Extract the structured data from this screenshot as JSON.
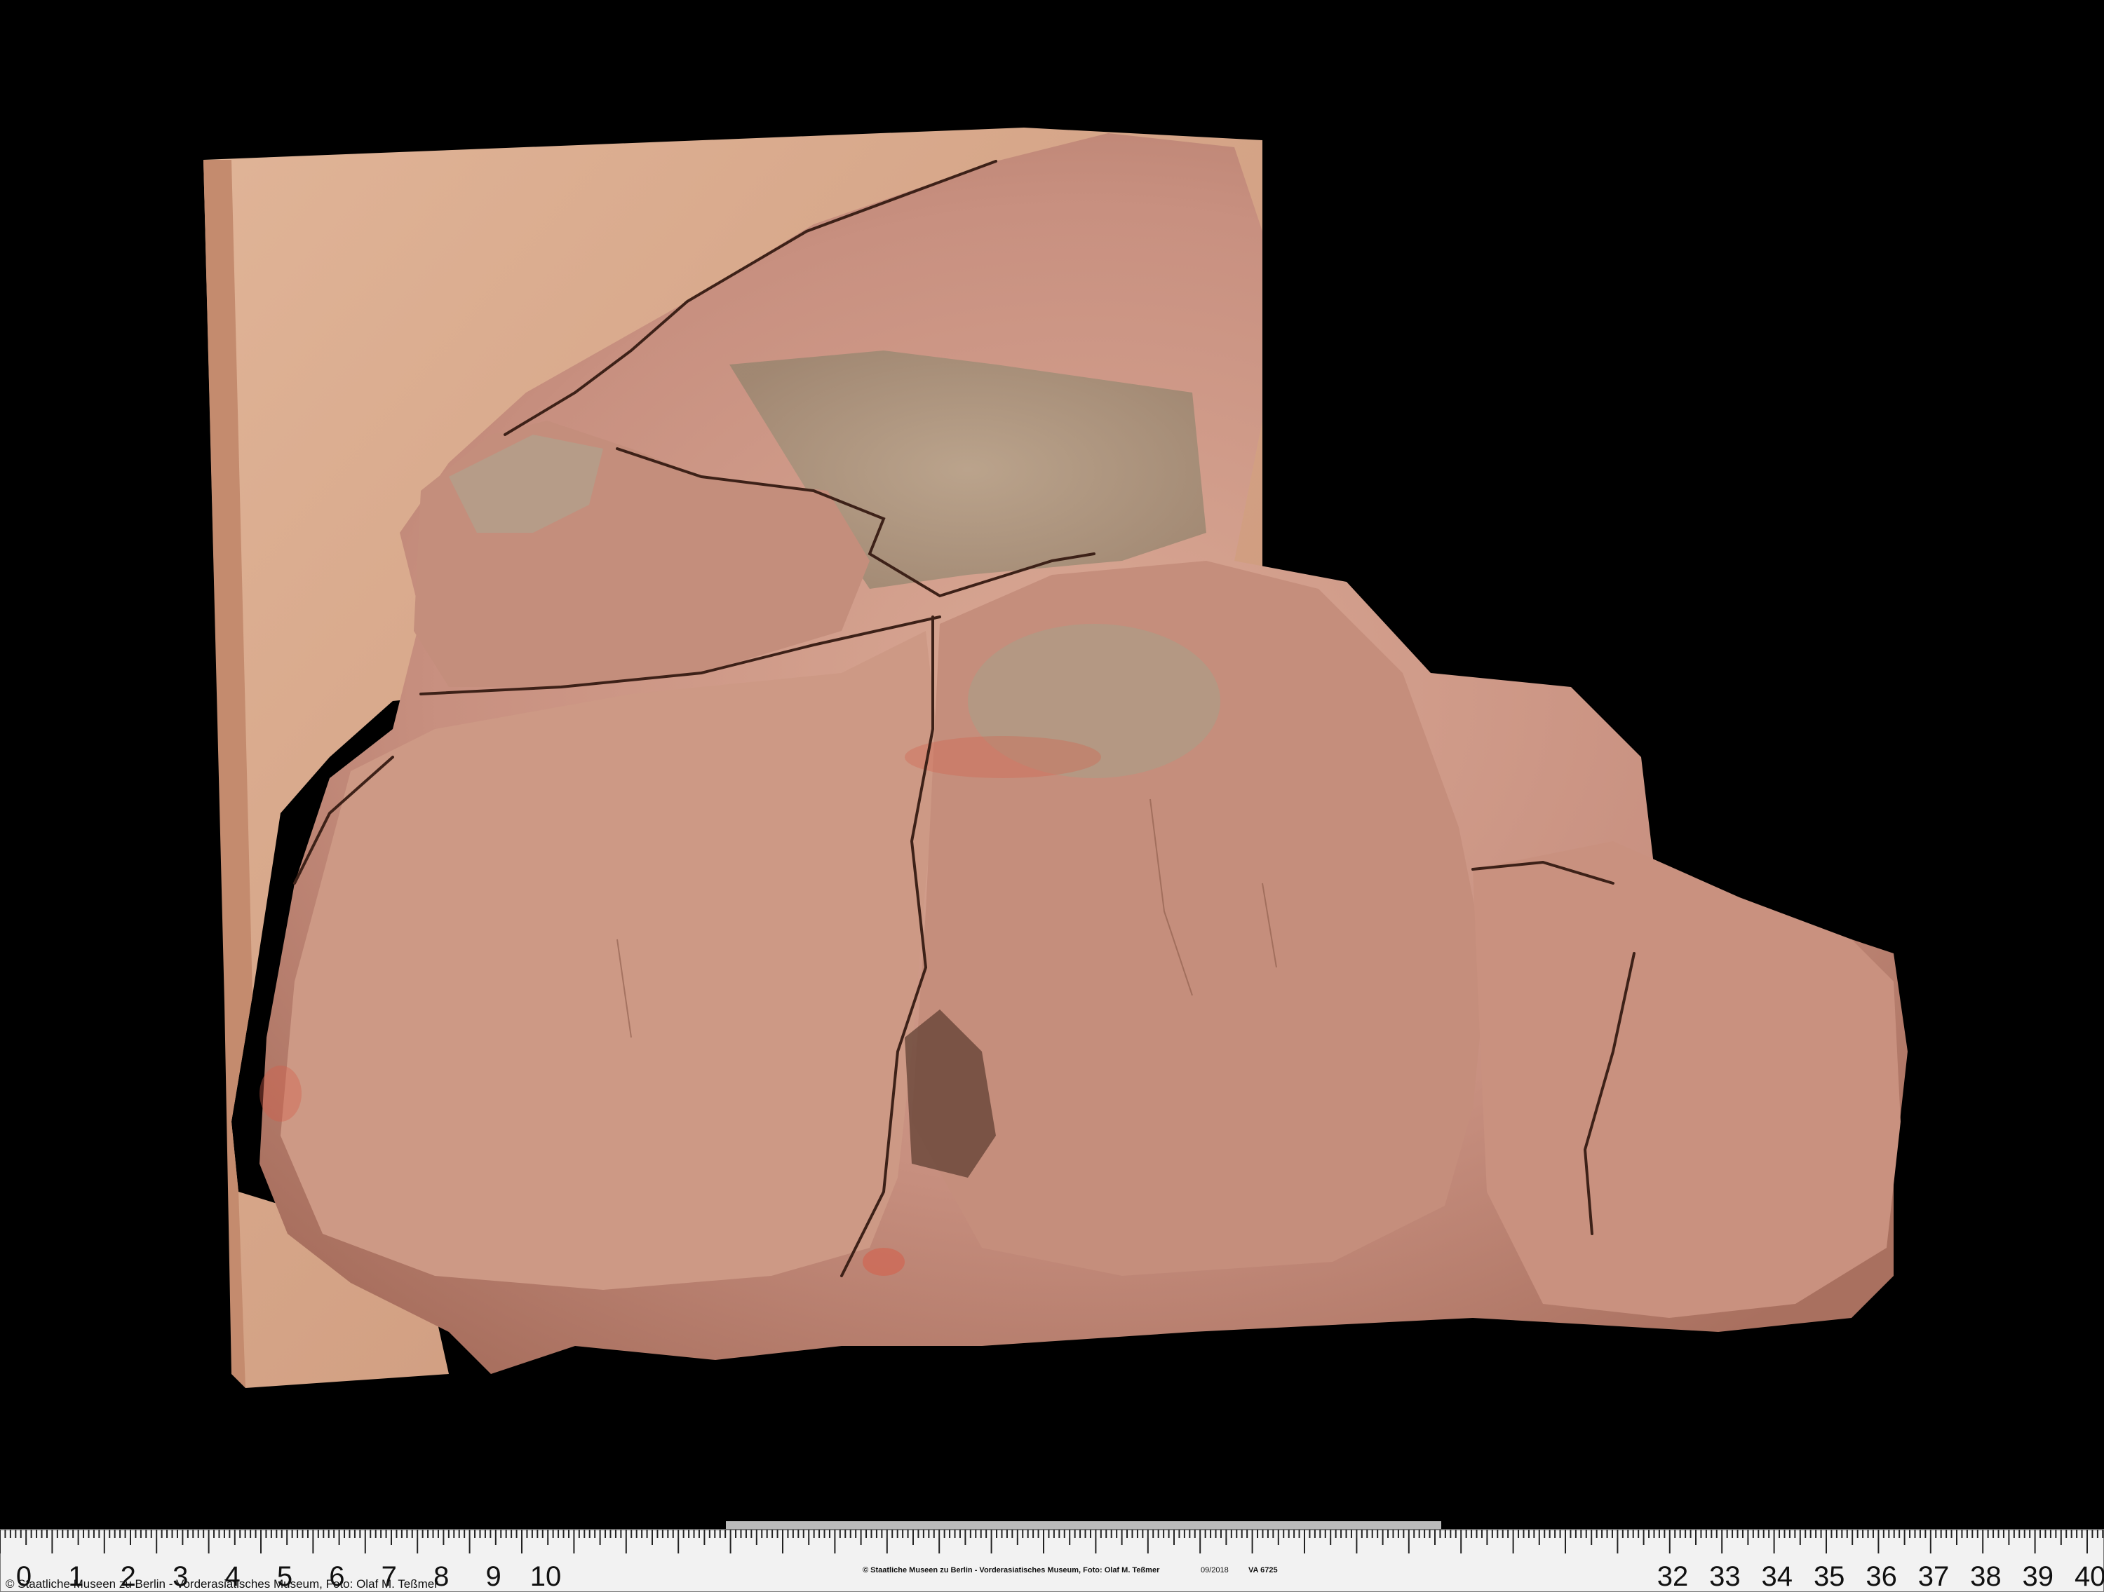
{
  "photo": {
    "subject": "fragment",
    "background_color": "#000000",
    "brick_color": "#d4a080",
    "stone_color": "#c98f7a",
    "stone_gray": "#a89880",
    "pigment_red": "#d4604c"
  },
  "scale_bar": {
    "left_numbers": [
      "0",
      "1",
      "2",
      "3",
      "4",
      "5",
      "6",
      "7",
      "8",
      "9",
      "10"
    ],
    "right_numbers": [
      "32",
      "33",
      "34",
      "35",
      "36",
      "37",
      "38",
      "39",
      "40"
    ]
  },
  "credits": {
    "left": "© Staatliche Museen zu Berlin - Vorderasiatisches Museum, Foto: Olaf M. Teßmer",
    "center": "© Staatliche Museen zu Berlin - Vorderasiatisches Museum, Foto: Olaf M. Teßmer",
    "date": "09/2018",
    "inventory": "VA 6725"
  }
}
